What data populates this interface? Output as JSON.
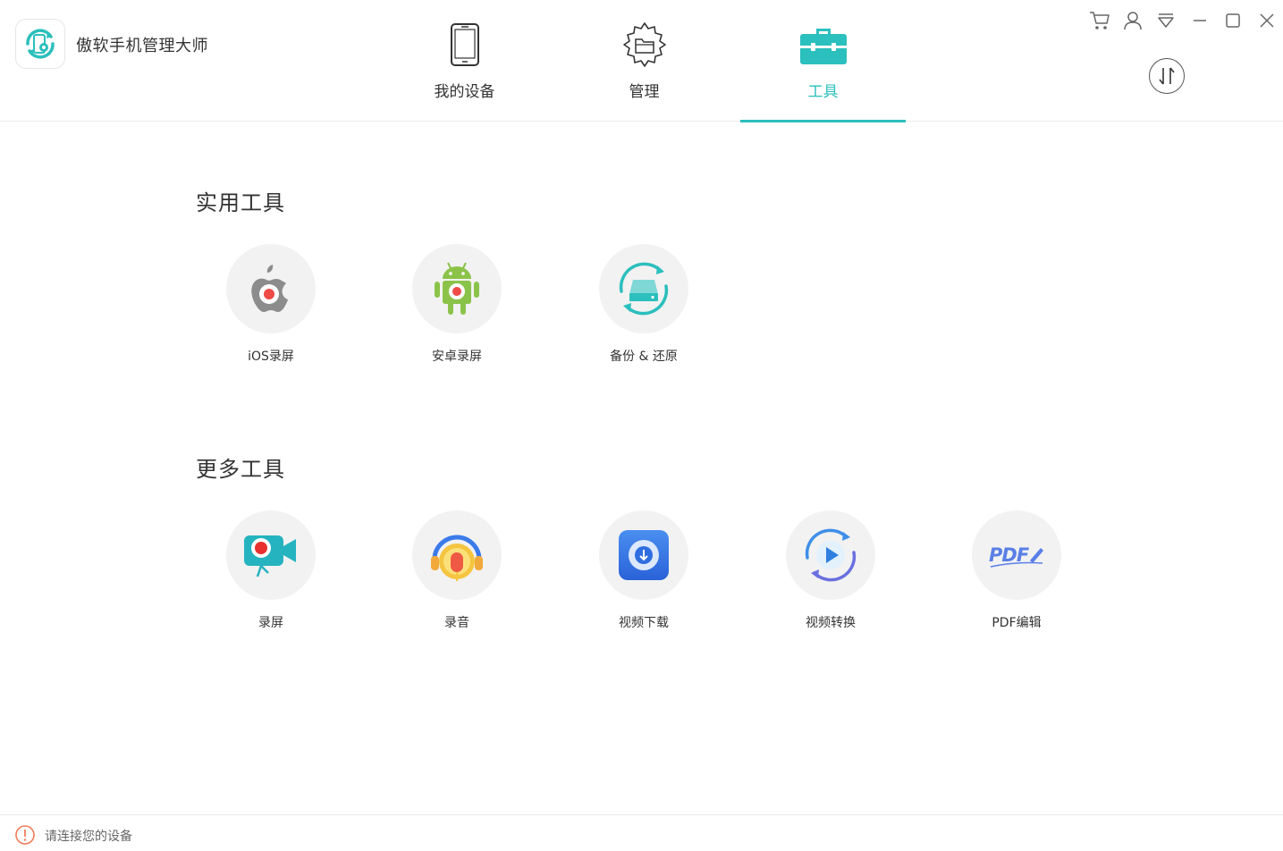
{
  "app": {
    "title": "傲软手机管理大师"
  },
  "nav": {
    "tabs": [
      {
        "label": "我的设备",
        "icon": "phone-icon"
      },
      {
        "label": "管理",
        "icon": "gear-folder-icon"
      },
      {
        "label": "工具",
        "icon": "toolbox-icon",
        "active": true
      }
    ]
  },
  "window_controls": [
    "cart-icon",
    "user-icon",
    "menu-dropdown-icon",
    "minimize-icon",
    "maximize-icon",
    "close-icon"
  ],
  "transfer_button_icon": "transfer-arrows-icon",
  "sections": {
    "practical": {
      "title": "实用工具",
      "tools": [
        {
          "label": "iOS录屏",
          "icon": "apple-record-icon"
        },
        {
          "label": "安卓录屏",
          "icon": "android-record-icon"
        },
        {
          "label": "备份 & 还原",
          "icon": "backup-restore-icon"
        }
      ]
    },
    "more": {
      "title": "更多工具",
      "tools": [
        {
          "label": "录屏",
          "icon": "screen-record-camera-icon"
        },
        {
          "label": "录音",
          "icon": "audio-record-icon"
        },
        {
          "label": "视频下载",
          "icon": "video-download-icon"
        },
        {
          "label": "视频转换",
          "icon": "video-convert-icon"
        },
        {
          "label": "PDF编辑",
          "icon": "pdf-edit-icon"
        }
      ]
    }
  },
  "footer": {
    "status": "请连接您的设备"
  },
  "colors": {
    "accent": "#2bbfbd",
    "warning": "#f07c5a",
    "tile_bg": "#f2f2f2"
  }
}
